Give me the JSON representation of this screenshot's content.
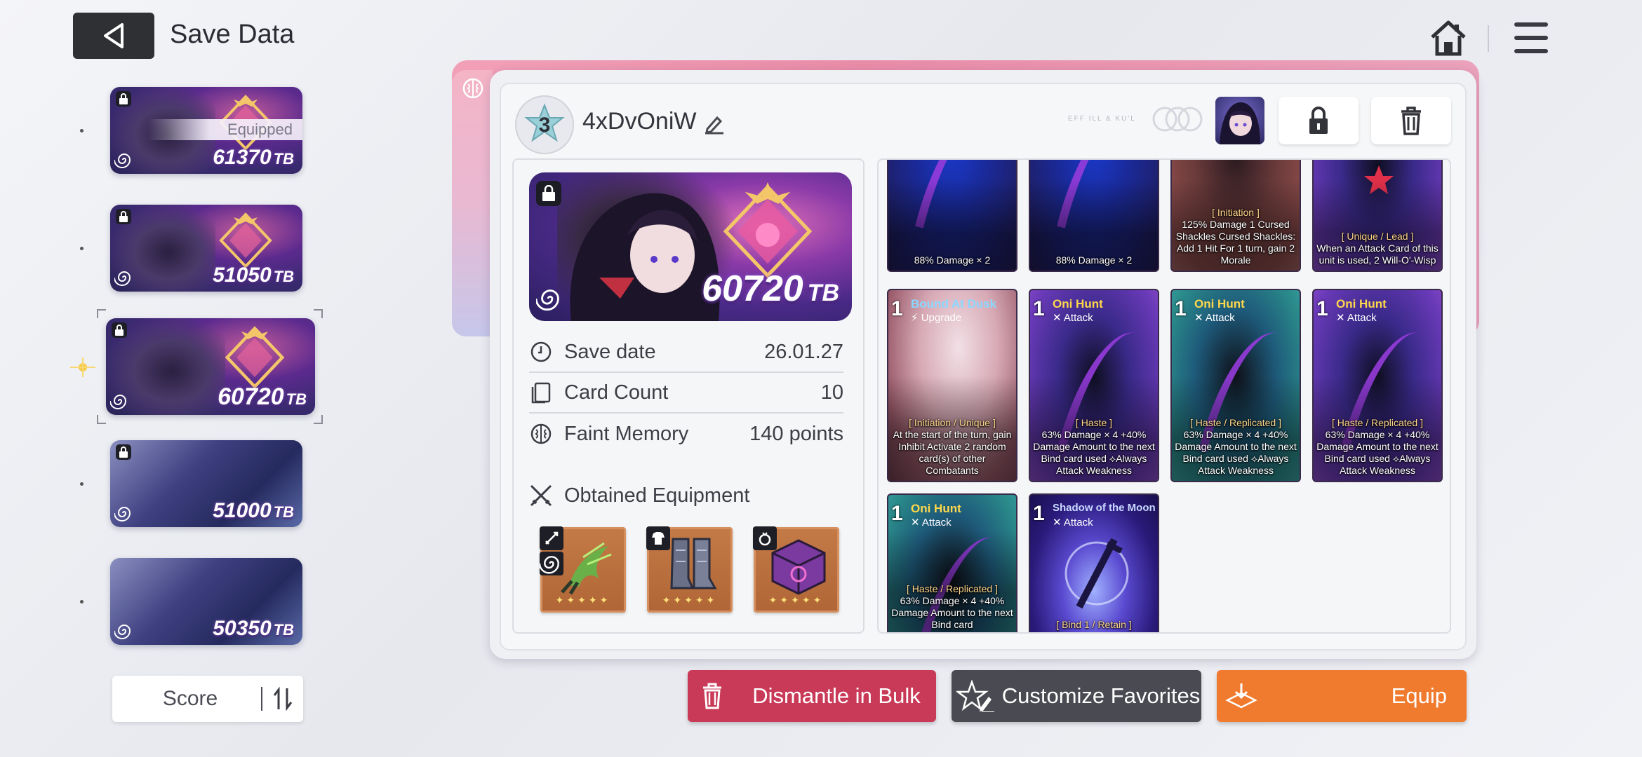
{
  "header": {
    "title": "Save Data"
  },
  "slots": [
    {
      "score": "61370",
      "unit": "TB",
      "equipped_label": "Equipped",
      "locked": true
    },
    {
      "score": "51050",
      "unit": "TB",
      "locked": true
    },
    {
      "score": "60720",
      "unit": "TB",
      "locked": true,
      "selected": true
    },
    {
      "score": "51000",
      "unit": "TB",
      "locked": true
    },
    {
      "score": "50350",
      "unit": "TB",
      "locked": false
    }
  ],
  "sort": {
    "label": "Score"
  },
  "detail": {
    "rank": "3",
    "name": "4xDvOniW",
    "faint_text": "EFF ILL & KU'L",
    "score": "60720",
    "unit": "TB",
    "rows": [
      {
        "label": "Save date",
        "value": "26.01.27"
      },
      {
        "label": "Card Count",
        "value": "10"
      },
      {
        "label": "Faint Memory",
        "value": "140 points"
      }
    ],
    "equipment_title": "Obtained Equipment",
    "equipment_stars": "✦✦✦✦✦"
  },
  "cards": [
    {
      "desc": "88% Damage × 2"
    },
    {
      "desc": "88% Damage × 2"
    },
    {
      "tag": "[ Initiation ]",
      "desc": "125% Damage 1 Cursed Shackles Cursed Shackles: Add 1 Hit For 1 turn, gain 2 Morale"
    },
    {
      "tag": "[ Unique / Lead ]",
      "desc": "When an Attack Card of this unit is used, 2 Will-O'-Wisp"
    },
    {
      "cost": "1",
      "name": "Bound At Dusk",
      "type": "⚡ Upgrade",
      "tag": "[ Initiation / Unique ]",
      "desc": "At the start of the turn, gain Inhibit Activate 2 random card(s) of other Combatants"
    },
    {
      "cost": "1",
      "name": "Oni Hunt",
      "type": "✕ Attack",
      "tag": "[ Haste ]",
      "desc": "63% Damage × 4 +40% Damage Amount to the next Bind card used ⟡Always Attack Weakness"
    },
    {
      "cost": "1",
      "name": "Oni Hunt",
      "type": "✕ Attack",
      "tag": "[ Haste / Replicated ]",
      "desc": "63% Damage × 4 +40% Damage Amount to the next Bind card used ⟡Always Attack Weakness"
    },
    {
      "cost": "1",
      "name": "Oni Hunt",
      "type": "✕ Attack",
      "tag": "[ Haste / Replicated ]",
      "desc": "63% Damage × 4 +40% Damage Amount to the next Bind card used ⟡Always Attack Weakness"
    },
    {
      "cost": "1",
      "name": "Oni Hunt",
      "type": "✕ Attack",
      "tag": "[ Haste / Replicated ]",
      "desc": "63% Damage × 4 +40% Damage Amount to the next Bind card"
    },
    {
      "cost": "1",
      "name": "Shadow of the Moon",
      "type": "✕ Attack",
      "tag": "[ Bind 1 / Retain ]",
      "desc": ""
    }
  ],
  "buttons": {
    "dismantle": "Dismantle in Bulk",
    "favorites": "Customize Favorites",
    "equip": "Equip"
  },
  "colors": {
    "dismantle": "#c93a58",
    "favorites": "#4a4b52",
    "equip": "#f07a2e",
    "panel_accent": "#e98ca8",
    "card_name_gold": "#ffd84a",
    "card_name_blue": "#8ad8ff"
  },
  "icons": [
    "back-arrow-icon",
    "home-icon",
    "menu-icon",
    "lock-icon",
    "swirl-icon",
    "edit-icon",
    "trash-icon",
    "clock-icon",
    "cards-icon",
    "brain-icon",
    "swords-icon",
    "sort-icon",
    "favorites-icon",
    "equip-icon",
    "sword-type-icon",
    "armor-type-icon",
    "ring-type-icon"
  ]
}
